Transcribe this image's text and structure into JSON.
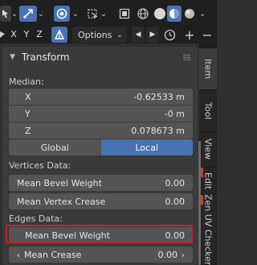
{
  "toolbar": {
    "options_label": "Options",
    "axes": [
      "X",
      "Y",
      "Z"
    ]
  },
  "tabs": [
    "Item",
    "Tool",
    "View",
    "Edit",
    "Zen UV Checker"
  ],
  "panel": {
    "title": "Transform",
    "median_label": "Median:",
    "median": [
      {
        "axis": "X",
        "value": "-0.62533 m"
      },
      {
        "axis": "Y",
        "value": "-0 m"
      },
      {
        "axis": "Z",
        "value": "0.078673 m"
      }
    ],
    "space": {
      "global": "Global",
      "local": "Local",
      "selected": "Local"
    },
    "vertices_label": "Vertices Data:",
    "vertices": [
      {
        "label": "Mean Bevel Weight",
        "value": "0.00"
      },
      {
        "label": "Mean Vertex Crease",
        "value": "0.00"
      }
    ],
    "edges_label": "Edges Data:",
    "edges": [
      {
        "label": "Mean Bevel Weight",
        "value": "0.00"
      },
      {
        "label": "Mean Crease",
        "value": "0.00"
      }
    ]
  },
  "colors": {
    "accent": "#4772b3",
    "highlight_border": "#c8232b"
  }
}
